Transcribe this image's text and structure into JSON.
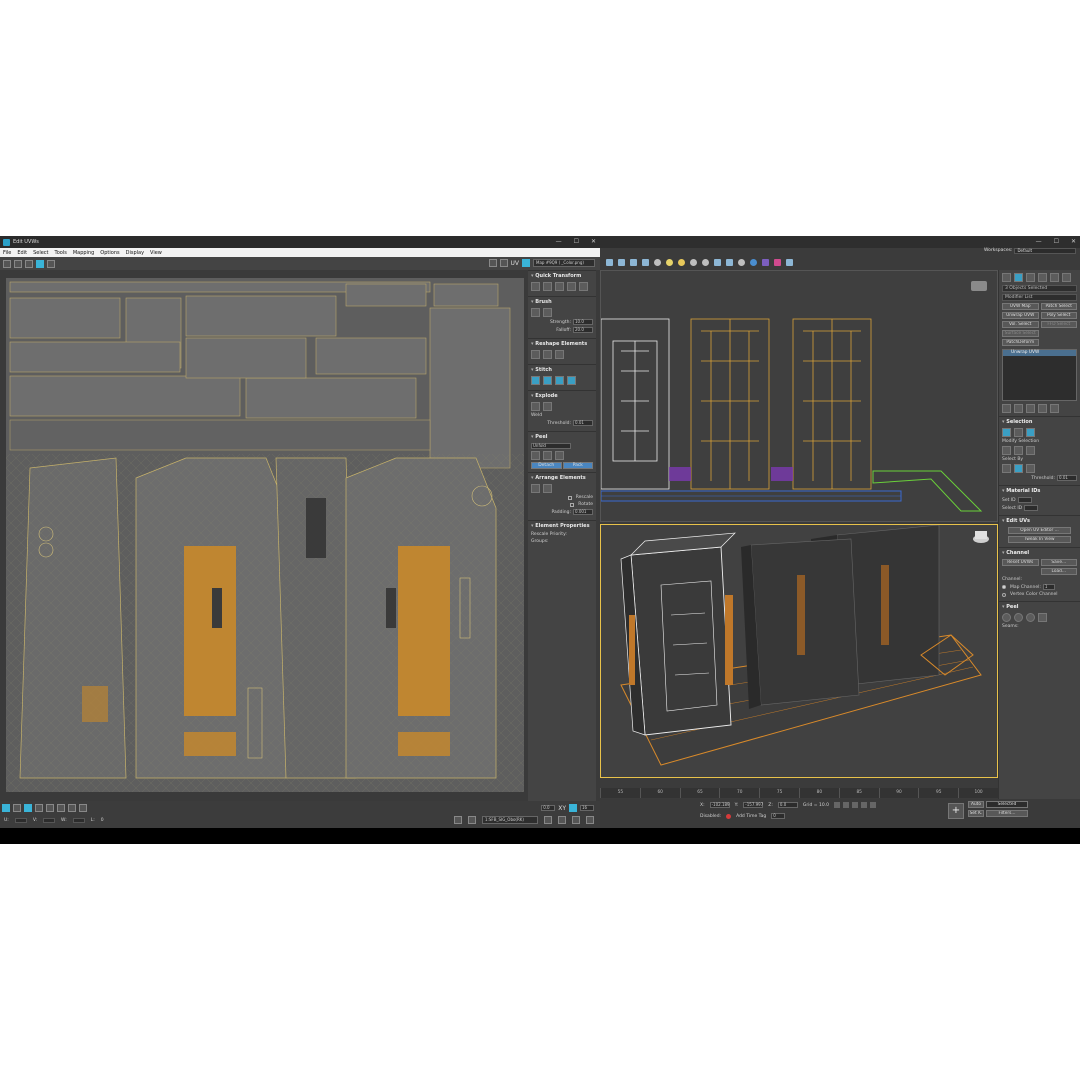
{
  "uv_editor": {
    "title": "Edit UVWs",
    "window_controls": [
      "—",
      "☐",
      "✕"
    ],
    "menu": [
      "File",
      "Edit",
      "Select",
      "Tools",
      "Mapping",
      "Options",
      "Display",
      "View"
    ],
    "uv_label": "UV",
    "map_select": "Map #9Q9 ( _Color.png)",
    "panel": {
      "quick_transform": "Quick Transform",
      "brush": "Brush",
      "strength_label": "Strength:",
      "strength_value": "10.0",
      "falloff_label": "Falloff:",
      "falloff_value": "20.0",
      "reshape": "Reshape Elements",
      "stitch": "Stitch",
      "explode": "Explode",
      "weld": "Weld",
      "threshold_label": "Threshold:",
      "threshold_value": "0.01",
      "peel": "Peel",
      "peel_mode": "Unfold",
      "detach": "Detach",
      "pack": "Pack",
      "arrange": "Arrange Elements",
      "rescale": "Rescale",
      "rotate": "Rotate",
      "padding_label": "Padding:",
      "padding_value": "0.001",
      "element_props": "Element Properties",
      "rescale_priority": "Rescale Priority:",
      "groups": "Groups:"
    },
    "bottom": {
      "u_label": "U:",
      "v_label": "V:",
      "w_label": "W:",
      "l_label": "L:",
      "l_value": "0",
      "zoom_value": "0.0",
      "xy_label": "XY",
      "uv_small": "UV",
      "grid_value": "16",
      "texture_select": "1:SFB_SIG_Obo(RK)"
    }
  },
  "max": {
    "workspaces_label": "Workspaces:",
    "workspace_value": "Default",
    "command_panel": {
      "objects_selected": "3 Objects Selected",
      "modifier_list": "Modifier List",
      "buttons": [
        "UVW Map",
        "Patch Select",
        "Unwrap UVW",
        "Poly Select",
        "Vol. Select",
        "FFD Select",
        "Surface Select",
        "PatchDeform"
      ],
      "stack_item": "Unwrap UVW",
      "selection": "Selection",
      "modify_selection": "Modify Selection",
      "select_by": "Select By",
      "threshold_label": "Threshold:",
      "threshold_value": "0.01",
      "material_ids": "Material IDs",
      "set_id": "Set ID",
      "select_id": "Select ID",
      "edit_uvs": "Edit UVs",
      "open_uv_editor": "Open UV Editor ...",
      "tweak_in_view": "Tweak In View",
      "channel": "Channel",
      "reset_uvws": "Reset UVWs",
      "save": "Save...",
      "load": "Load...",
      "channel_label": "Channel:",
      "map_channel": "Map Channel:",
      "map_channel_value": "1",
      "vertex_color_channel": "Vertex Color Channel",
      "peel": "Peel",
      "seams": "Seams:"
    },
    "timeline_ticks": [
      "55",
      "60",
      "65",
      "70",
      "75",
      "80",
      "85",
      "90",
      "95",
      "100"
    ],
    "timeline_ticks_right": [
      "86",
      "88",
      "90",
      "92",
      "94",
      "96",
      "98",
      "100"
    ],
    "status": {
      "x_label": "X:",
      "x_value": "-102.189",
      "y_label": "Y:",
      "y_value": "-157.997",
      "z_label": "Z:",
      "z_value": "0.0",
      "grid": "Grid = 10.0",
      "disabled": "Disabled:",
      "add_time_tag": "Add Time Tag",
      "auto": "Auto",
      "selected": "Selected",
      "set_k": "Set K.",
      "filters": "Filters...",
      "frame_value": "0"
    }
  }
}
